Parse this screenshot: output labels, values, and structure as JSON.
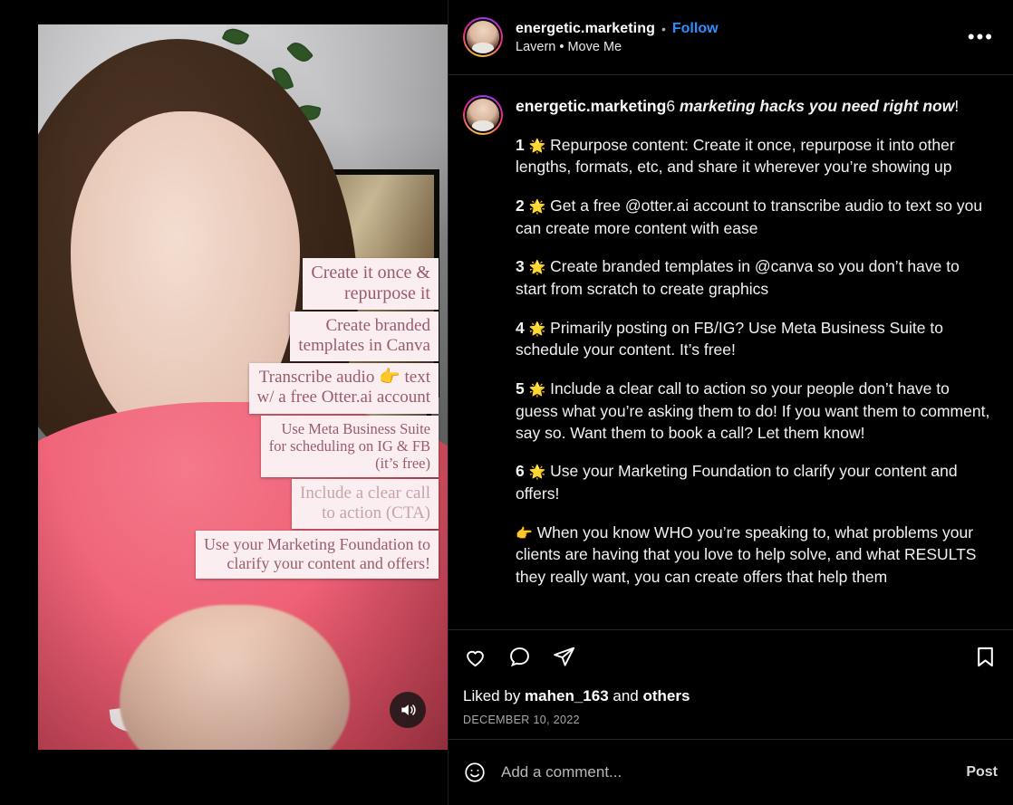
{
  "header": {
    "username": "energetic.marketing",
    "separator": "•",
    "follow_label": "Follow",
    "subtitle": "Lavern • Move Me",
    "more_icon": "•••",
    "avatar_icon": "avatar"
  },
  "caption": {
    "username": "energetic.marketing",
    "title_plain": "6 ",
    "title_emph": "marketing hacks you need right now",
    "title_end": "!",
    "items": [
      {
        "number": "1",
        "emoji": "🌟",
        "text": "Repurpose content: Create it once, repurpose it into other lengths, formats, etc, and share it wherever you’re showing up"
      },
      {
        "number": "2",
        "emoji": "🌟",
        "text": "Get a free @otter.ai account to transcribe audio to text so you can create more content with ease"
      },
      {
        "number": "3",
        "emoji": "🌟",
        "text": "Create branded templates in @canva so you don’t have to start from scratch to create graphics"
      },
      {
        "number": "4",
        "emoji": "🌟",
        "text": "Primarily posting on FB/IG? Use Meta Business Suite to schedule your content. It’s free!"
      },
      {
        "number": "5",
        "emoji": "🌟",
        "text": "Include a clear call to action so your people don’t have to guess what you’re asking them to do! If you want them to comment, say so. Want them to book a call? Let them know!"
      },
      {
        "number": "6",
        "emoji": "🌟",
        "text": "Use your Marketing Foundation to clarify your content and offers!"
      }
    ],
    "closing_emoji": "👉",
    "closing_text": "When you know WHO you’re speaking to, what problems your clients are having that you love to help solve, and what RESULTS they really want, you can create offers that help them"
  },
  "actions": {
    "like_icon": "heart-icon",
    "comment_icon": "comment-icon",
    "share_icon": "share-icon",
    "save_icon": "bookmark-icon",
    "liked_prefix": "Liked by ",
    "liked_user": "mahen_163",
    "liked_middle": " and ",
    "liked_suffix": "others",
    "date": "DECEMBER 10, 2022"
  },
  "comment_box": {
    "emoji_icon": "emoji-smiley-icon",
    "placeholder": "Add a comment...",
    "value": "",
    "post_label": "Post"
  },
  "video": {
    "sound_icon": "volume-on-icon",
    "overlay_captions": [
      "Create it once &\nrepurpose it",
      "Create branded\ntemplates in Canva",
      "Transcribe audio 👉 text\nw/ a free Otter.ai account",
      "Use Meta Business Suite\nfor scheduling on IG & FB\n(it’s free)",
      "Include a clear call\nto action (CTA)",
      "Use your Marketing Foundation to\nclarify your content and offers!"
    ]
  },
  "colors": {
    "background": "#000000",
    "follow_blue": "#2d8eff",
    "caption_box_bg": "#fbeef1",
    "caption_box_text": "#9a5c6a",
    "divider": "#262626"
  }
}
